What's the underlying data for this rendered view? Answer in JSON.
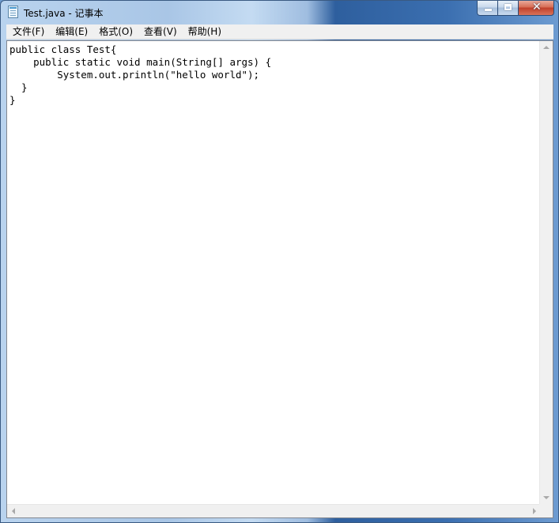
{
  "window": {
    "title": "Test.java - 记事本",
    "icon": "notepad-icon"
  },
  "caption_buttons": {
    "minimize": "minimize-icon",
    "maximize": "maximize-icon",
    "close_glyph": "✕"
  },
  "menu": {
    "items": [
      {
        "label": "文件(F)"
      },
      {
        "label": "编辑(E)"
      },
      {
        "label": "格式(O)"
      },
      {
        "label": "查看(V)"
      },
      {
        "label": "帮助(H)"
      }
    ]
  },
  "editor": {
    "content": "public class Test{\n    public static void main(String[] args) {\n        System.out.println(\"hello world\");\n  }\n}"
  },
  "colors": {
    "titlebar_active": "#3b6fb0",
    "close_button": "#c0402a",
    "menu_bg": "#f0f0f0",
    "editor_bg": "#ffffff"
  }
}
